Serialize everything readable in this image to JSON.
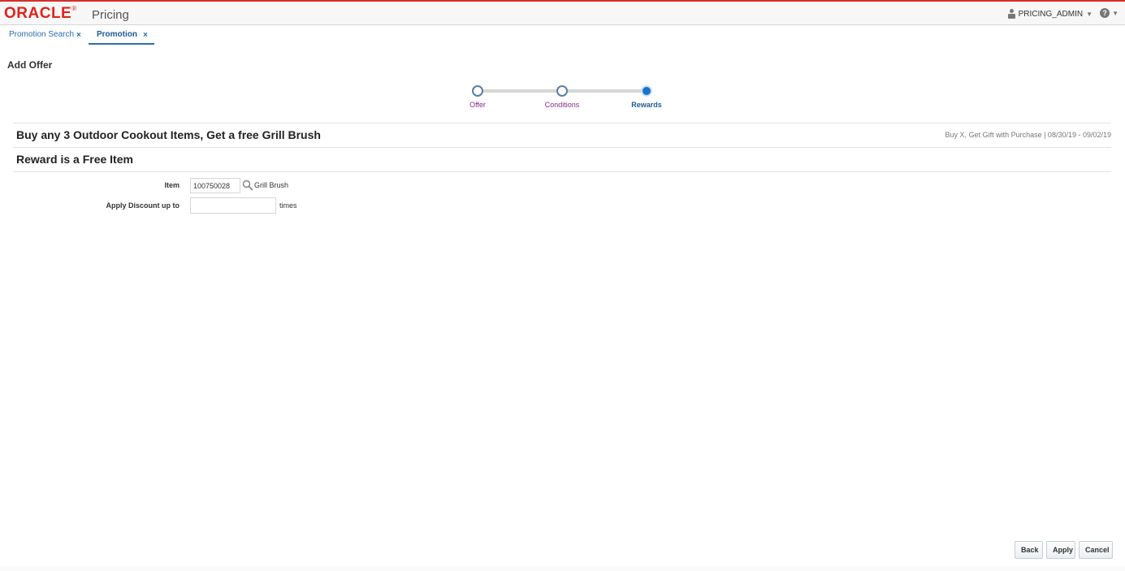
{
  "header": {
    "logo_text": "ORACLE",
    "logo_mark": "®",
    "app_name": "Pricing",
    "user_name": "PRICING_ADMIN",
    "help_symbol": "?",
    "caret": "▼",
    "icons": {
      "user": "user-icon",
      "help": "help-icon"
    },
    "brand_color": "#e2231a"
  },
  "tabs": [
    {
      "label": "Promotion Search",
      "close": "×"
    },
    {
      "label": "Promotion",
      "close": "×",
      "active": true
    }
  ],
  "page": {
    "title": "Add Offer"
  },
  "train": {
    "stops": [
      {
        "label": "Offer",
        "state": "visited"
      },
      {
        "label": "Conditions",
        "state": "visited"
      },
      {
        "label": "Rewards",
        "state": "current"
      }
    ],
    "current_color": "#1a73c8",
    "visited_label_color": "#8a2a8f"
  },
  "offer": {
    "title": "Buy any 3 Outdoor Cookout Items, Get a free Grill Brush",
    "meta": "Buy X, Get Gift with Purchase | 08/30/19 - 09/02/19"
  },
  "reward": {
    "title": "Reward is a Free Item",
    "item_label": "Item",
    "item_value": "100750028",
    "item_description": "Grill Brush",
    "apply_label": "Apply Discount up to",
    "apply_value": "",
    "apply_suffix": "times",
    "search_icon": "search-icon"
  },
  "buttons": {
    "back": "Back",
    "apply": "Apply",
    "cancel": "Cancel"
  }
}
